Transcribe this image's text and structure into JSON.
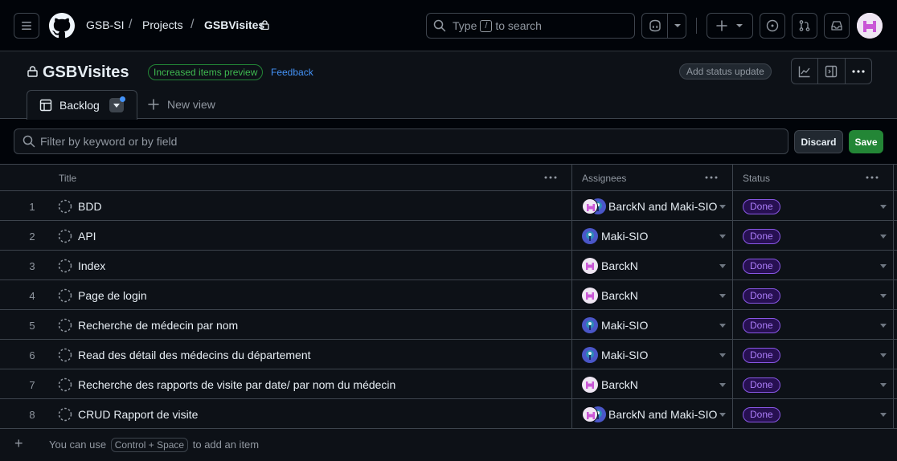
{
  "header": {
    "breadcrumb": {
      "org": "GSB-SI",
      "section": "Projects",
      "project": "GSBVisites",
      "sep1": "/",
      "sep2": "/"
    },
    "search": {
      "prefix": "Type",
      "key": "/",
      "suffix": "to search"
    }
  },
  "project": {
    "title": "GSBVisites",
    "preview_badge": "Increased items preview",
    "feedback_link": "Feedback",
    "status_update_button": "Add status update"
  },
  "tabs": {
    "active_label": "Backlog",
    "new_view_label": "New view"
  },
  "filter": {
    "placeholder": "Filter by keyword or by field",
    "discard_label": "Discard",
    "save_label": "Save"
  },
  "table": {
    "columns": [
      "Title",
      "Assignees",
      "Status"
    ],
    "rows": [
      {
        "num": "1",
        "title": "BDD",
        "assignees": "BarckN and Maki-SIO",
        "avatar": "pair",
        "status": "Done"
      },
      {
        "num": "2",
        "title": "API",
        "assignees": "Maki-SIO",
        "avatar": "maki",
        "status": "Done"
      },
      {
        "num": "3",
        "title": "Index",
        "assignees": "BarckN",
        "avatar": "barck",
        "status": "Done"
      },
      {
        "num": "4",
        "title": "Page de login",
        "assignees": "BarckN",
        "avatar": "barck",
        "status": "Done"
      },
      {
        "num": "5",
        "title": "Recherche de médecin par nom",
        "assignees": "Maki-SIO",
        "avatar": "maki",
        "status": "Done"
      },
      {
        "num": "6",
        "title": "Read des détail des médecins du département",
        "assignees": "Maki-SIO",
        "avatar": "maki",
        "status": "Done"
      },
      {
        "num": "7",
        "title": "Recherche des rapports de visite par date/ par nom du médecin",
        "assignees": "BarckN",
        "avatar": "barck",
        "status": "Done"
      },
      {
        "num": "8",
        "title": "CRUD Rapport de visite",
        "assignees": "BarckN and Maki-SIO",
        "avatar": "pair",
        "status": "Done"
      }
    ],
    "add_item": {
      "prefix": "You can use",
      "shortcut": "Control + Space",
      "suffix": "to add an item"
    }
  },
  "colors": {
    "background": "#0d1117",
    "header_bg": "#010409",
    "border": "#3d444d",
    "accent_blue": "#4493f8",
    "save_green": "#238636",
    "done_purple": "#ab7df8",
    "avatar_barck": "#c957d6",
    "avatar_maki": "#4a56c8"
  }
}
